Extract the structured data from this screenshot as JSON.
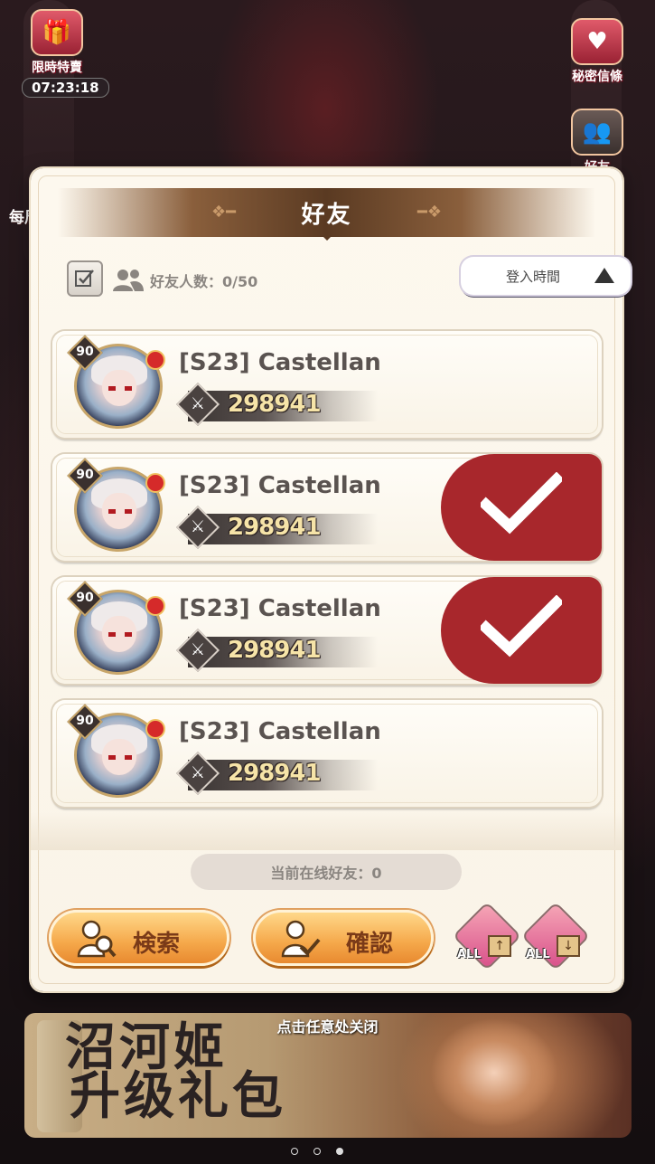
{
  "hud": {
    "limited_sale_label": "限時特賣",
    "limited_sale_timer": "07:23:18",
    "secret_letter_label": "秘密信條",
    "friends_label": "好友",
    "daily_label": "每周"
  },
  "modal": {
    "title": "好友",
    "friend_count_label": "好友人数：0/50",
    "sort_label": "登入時間",
    "online_label": "当前在线好友：0",
    "search_button": "検索",
    "confirm_button": "確認",
    "all_tag": "ALL"
  },
  "friends": [
    {
      "level": "90",
      "name": "[S23] Castellan",
      "power": "298941",
      "selected": false
    },
    {
      "level": "90",
      "name": "[S23] Castellan",
      "power": "298941",
      "selected": true
    },
    {
      "level": "90",
      "name": "[S23] Castellan",
      "power": "298941",
      "selected": true
    },
    {
      "level": "90",
      "name": "[S23] Castellan",
      "power": "298941",
      "selected": false
    }
  ],
  "close_hint": "点击任意处关闭",
  "banner": {
    "title_line1": "沼河姬",
    "title_line2": "升级礼包"
  },
  "colors": {
    "selected": "#a8272c",
    "button_orange": "#f5a84a",
    "title_brown": "#5a3a22"
  }
}
